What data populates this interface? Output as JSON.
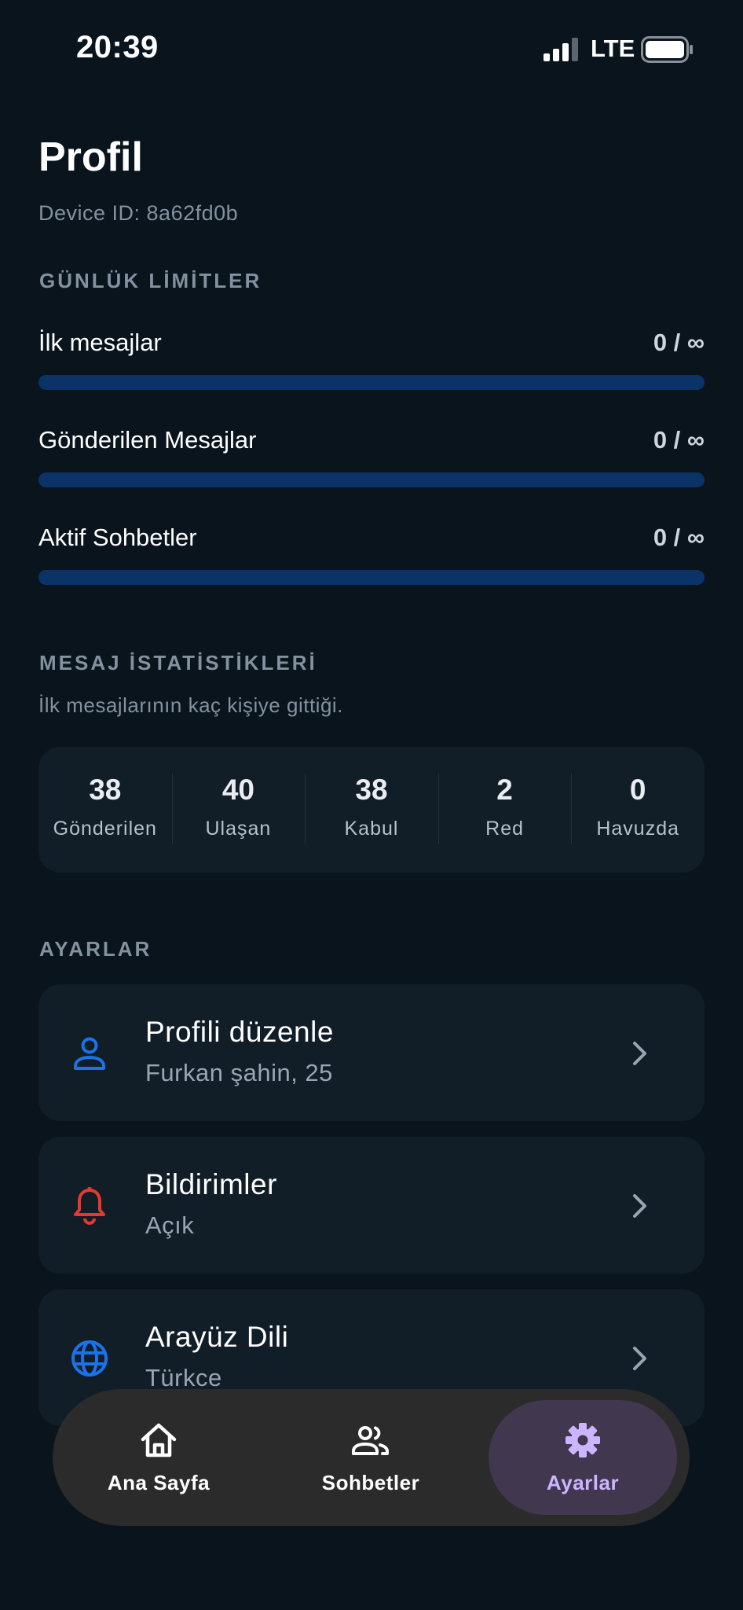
{
  "status": {
    "time": "20:39",
    "network": "LTE"
  },
  "header": {
    "title": "Profil",
    "device_id": "Device ID: 8a62fd0b"
  },
  "limits": {
    "section_label": "GÜNLÜK LİMİTLER",
    "items": [
      {
        "label": "İlk mesajlar",
        "value": "0 / ∞",
        "fill": 0
      },
      {
        "label": "Gönderilen Mesajlar",
        "value": "0 / ∞",
        "fill": 0
      },
      {
        "label": "Aktif Sohbetler",
        "value": "0 / ∞",
        "fill": 0
      }
    ]
  },
  "stats": {
    "section_label": "MESAJ İSTATİSTİKLERİ",
    "subtitle": "İlk mesajlarının kaç kişiye gittiği.",
    "items": [
      {
        "value": "38",
        "label": "Gönderilen"
      },
      {
        "value": "40",
        "label": "Ulaşan"
      },
      {
        "value": "38",
        "label": "Kabul"
      },
      {
        "value": "2",
        "label": "Red"
      },
      {
        "value": "0",
        "label": "Havuzda"
      }
    ]
  },
  "settings": {
    "section_label": "AYARLAR",
    "items": [
      {
        "title": "Profili düzenle",
        "subtitle": "Furkan şahin, 25",
        "icon": "person-icon",
        "icon_color": "#1a73e8"
      },
      {
        "title": "Bildirimler",
        "subtitle": "Açık",
        "icon": "bell-icon",
        "icon_color": "#e5382f"
      },
      {
        "title": "Arayüz Dili",
        "subtitle": "Türkce",
        "icon": "globe-icon",
        "icon_color": "#1a73e8"
      }
    ]
  },
  "nav": {
    "items": [
      {
        "label": "Ana Sayfa",
        "icon": "home-icon",
        "active": false
      },
      {
        "label": "Sohbetler",
        "icon": "people-icon",
        "active": false
      },
      {
        "label": "Ayarlar",
        "icon": "gear-icon",
        "active": true
      }
    ]
  },
  "colors": {
    "background": "#0a141d",
    "card": "#111d27",
    "progress_track": "#0c3367",
    "active_accent": "#cdb4ff"
  }
}
